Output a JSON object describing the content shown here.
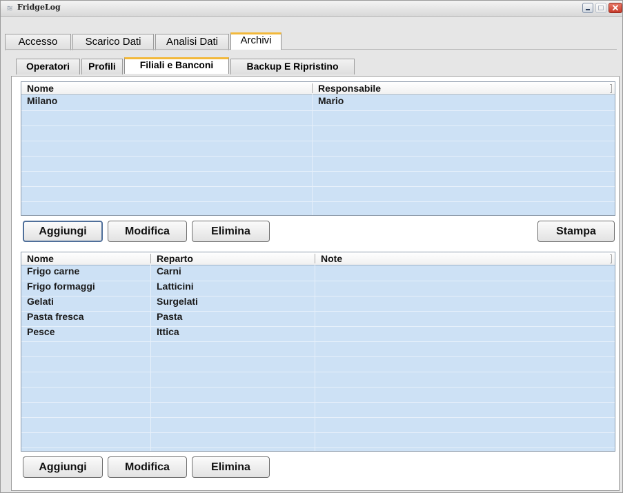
{
  "window": {
    "title": "FridgeLog",
    "controls": [
      "minimize-icon",
      "maximize-icon",
      "close-icon"
    ],
    "close_glyph": "✕"
  },
  "main_tabs": {
    "items": [
      {
        "label": "Accesso",
        "active": false
      },
      {
        "label": "Scarico Dati",
        "active": false
      },
      {
        "label": "Analisi Dati",
        "active": false
      },
      {
        "label": "Archivi",
        "active": true
      }
    ]
  },
  "sub_tabs": {
    "items": [
      {
        "label": "Operatori",
        "active": false
      },
      {
        "label": "Profili",
        "active": false
      },
      {
        "label": "Filiali e Banconi",
        "active": true
      },
      {
        "label": "Backup E Ripristino",
        "active": false
      }
    ]
  },
  "filiali_table": {
    "columns": [
      "Nome",
      "Responsabile"
    ],
    "rows": [
      [
        "Milano",
        "Mario"
      ]
    ]
  },
  "filiali_buttons": {
    "add": "Aggiungi",
    "edit": "Modifica",
    "delete": "Elimina",
    "print": "Stampa"
  },
  "banconi_table": {
    "columns": [
      "Nome",
      "Reparto",
      "Note"
    ],
    "rows": [
      [
        "Frigo carne",
        "Carni",
        ""
      ],
      [
        "Frigo formaggi",
        "Latticini",
        ""
      ],
      [
        "Gelati",
        "Surgelati",
        ""
      ],
      [
        "Pasta fresca",
        "Pasta",
        ""
      ],
      [
        "Pesce",
        "Ittica",
        ""
      ]
    ]
  },
  "banconi_buttons": {
    "add": "Aggiungi",
    "edit": "Modifica",
    "delete": "Elimina"
  },
  "colors": {
    "active_tab_accent": "#f2b83a",
    "table_background": "#cde1f5",
    "primary_button_border": "#4f6f9a"
  }
}
